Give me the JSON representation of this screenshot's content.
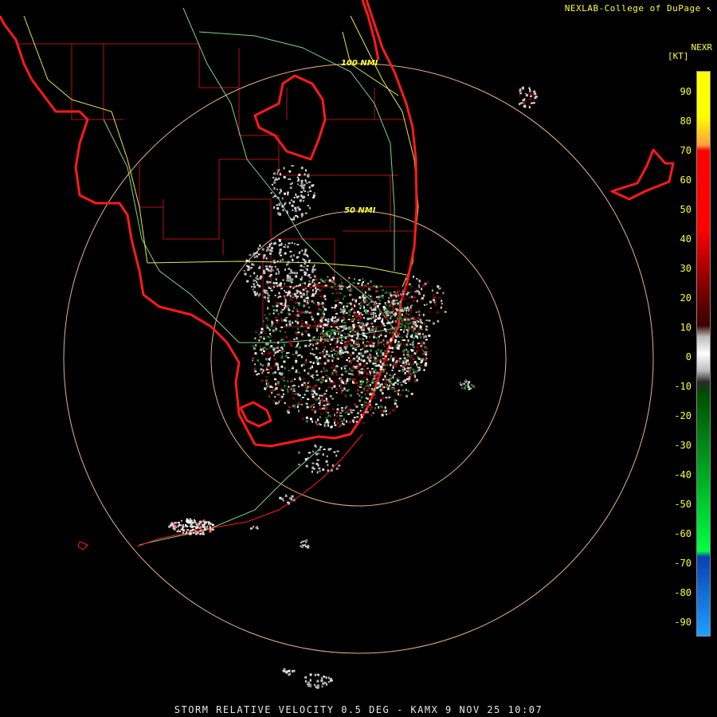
{
  "header": {
    "credit": "NEXLAB-College of DuPage",
    "credit_icon": "nexlab-logo-icon"
  },
  "legend": {
    "title": "NEXR",
    "unit": "[KT]",
    "ticks": [
      "90",
      "80",
      "70",
      "60",
      "50",
      "40",
      "30",
      "20",
      "10",
      "0",
      "-10",
      "-20",
      "-30",
      "-40",
      "-50",
      "-60",
      "-70",
      "-80",
      "-90"
    ],
    "colors": {
      "high": "#ffff00",
      "orange": "#ffa040",
      "red": "#ff0000",
      "darkred": "#6a0000",
      "gray": "#bbbbbb",
      "darkgreen": "#004d00",
      "green": "#00ff44",
      "blue": "#0a3fb0",
      "skyblue": "#1ea0ff"
    }
  },
  "range_rings": {
    "inner_label": "50 NMI",
    "outer_label": "100 NMI"
  },
  "footer": {
    "caption": "STORM RELATIVE VELOCITY 0.5 DEG - KAMX 9 NOV 25 10:07"
  },
  "colors": {
    "coast": "#ff1a1a",
    "county": "#b31212",
    "roads": "#e8e84a",
    "highways": "#7fd38a",
    "rings": "#e6b38a"
  }
}
